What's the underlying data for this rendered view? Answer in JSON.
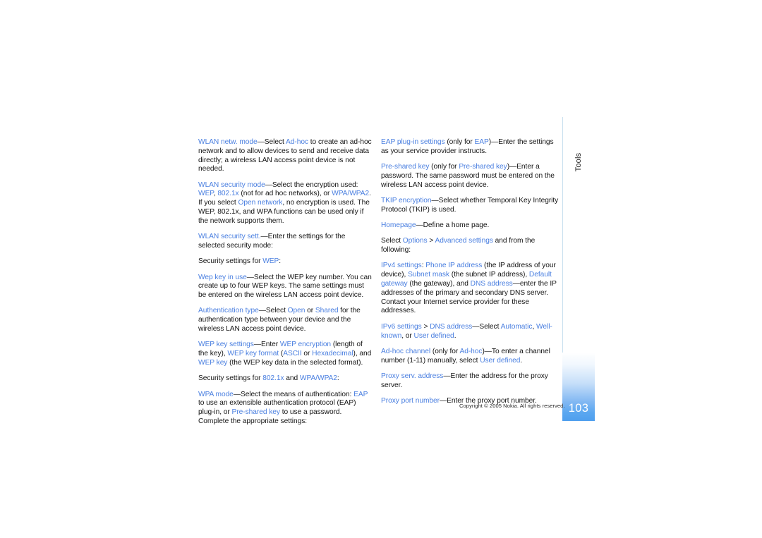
{
  "document": {
    "page_number": "103",
    "side_tab_label": "Tools",
    "copyright": "Copyright © 2005 Nokia. All rights reserved.",
    "accent_color": "#4a7fe0",
    "tab_color": "#5aa7f0"
  },
  "left_column": {
    "paragraphs": [
      {
        "id": "wlan-netw-mode",
        "runs": [
          {
            "t": "WLAN netw. mode",
            "k": true
          },
          {
            "t": "—Select "
          },
          {
            "t": "Ad-hoc",
            "k": true
          },
          {
            "t": " to create an ad-hoc network and to allow devices to send and receive data directly; a wireless LAN access point device is not needed."
          }
        ]
      },
      {
        "id": "wlan-security-mode",
        "runs": [
          {
            "t": "WLAN security mode",
            "k": true
          },
          {
            "t": "—Select the encryption used: "
          },
          {
            "t": "WEP",
            "k": true
          },
          {
            "t": ", "
          },
          {
            "t": "802.1x",
            "k": true
          },
          {
            "t": " (not for ad hoc networks), or "
          },
          {
            "t": "WPA/WPA2",
            "k": true
          },
          {
            "t": ". If you select "
          },
          {
            "t": "Open network",
            "k": true
          },
          {
            "t": ", no encryption is used. The WEP, 802.1x, and WPA functions can be used only if the network supports them."
          }
        ]
      },
      {
        "id": "wlan-security-sett",
        "runs": [
          {
            "t": "WLAN security sett.",
            "k": true
          },
          {
            "t": "—Enter the settings for the selected security mode:"
          }
        ]
      },
      {
        "id": "security-settings-wep",
        "runs": [
          {
            "t": "Security settings for "
          },
          {
            "t": "WEP",
            "k": true
          },
          {
            "t": ":"
          }
        ]
      },
      {
        "id": "wep-key-in-use",
        "runs": [
          {
            "t": "Wep key in use",
            "k": true
          },
          {
            "t": "—Select the WEP key number. You can create up to four WEP keys. The same settings must be entered on the wireless LAN access point device."
          }
        ]
      },
      {
        "id": "authentication-type",
        "runs": [
          {
            "t": "Authentication type",
            "k": true
          },
          {
            "t": "—Select "
          },
          {
            "t": "Open",
            "k": true
          },
          {
            "t": " or "
          },
          {
            "t": "Shared",
            "k": true
          },
          {
            "t": " for the authentication type between your device and the wireless LAN access point device."
          }
        ]
      },
      {
        "id": "wep-key-settings",
        "runs": [
          {
            "t": "WEP key settings",
            "k": true
          },
          {
            "t": "—Enter "
          },
          {
            "t": "WEP encryption",
            "k": true
          },
          {
            "t": " (length of the key), "
          },
          {
            "t": "WEP key format",
            "k": true
          },
          {
            "t": " ("
          },
          {
            "t": "ASCII",
            "k": true
          },
          {
            "t": " or "
          },
          {
            "t": "Hexadecimal",
            "k": true
          },
          {
            "t": "), and "
          },
          {
            "t": "WEP key",
            "k": true
          },
          {
            "t": " (the WEP key data in the selected format)."
          }
        ]
      },
      {
        "id": "security-settings-8021x",
        "runs": [
          {
            "t": "Security settings for "
          },
          {
            "t": "802.1x",
            "k": true
          },
          {
            "t": " and "
          },
          {
            "t": "WPA/WPA2",
            "k": true
          },
          {
            "t": ":"
          }
        ]
      },
      {
        "id": "wpa-mode",
        "runs": [
          {
            "t": "WPA mode",
            "k": true
          },
          {
            "t": "—Select the means of authentication: "
          },
          {
            "t": "EAP",
            "k": true
          },
          {
            "t": " to use an extensible authentication protocol (EAP) plug-in, or "
          },
          {
            "t": "Pre-shared key",
            "k": true
          },
          {
            "t": " to use a password. Complete the appropriate settings:"
          }
        ]
      }
    ]
  },
  "right_column": {
    "paragraphs": [
      {
        "id": "eap-plug-in-settings",
        "runs": [
          {
            "t": "EAP plug-in settings",
            "k": true
          },
          {
            "t": " (only for "
          },
          {
            "t": "EAP",
            "k": true
          },
          {
            "t": ")—Enter the settings as your service provider instructs."
          }
        ]
      },
      {
        "id": "pre-shared-key",
        "runs": [
          {
            "t": "Pre-shared key",
            "k": true
          },
          {
            "t": " (only for "
          },
          {
            "t": "Pre-shared key",
            "k": true
          },
          {
            "t": ")—Enter a password. The same password must be entered on the wireless LAN access point device."
          }
        ]
      },
      {
        "id": "tkip-encryption",
        "runs": [
          {
            "t": "TKIP encryption",
            "k": true
          },
          {
            "t": "—Select whether Temporal Key Integrity Protocol (TKIP) is used."
          }
        ]
      },
      {
        "id": "homepage",
        "runs": [
          {
            "t": "Homepage",
            "k": true
          },
          {
            "t": "—Define a home page."
          }
        ]
      },
      {
        "id": "select-options",
        "runs": [
          {
            "t": "Select "
          },
          {
            "t": "Options",
            "k": true
          },
          {
            "t": " > "
          },
          {
            "t": "Advanced settings",
            "k": true
          },
          {
            "t": " and from the following:"
          }
        ]
      },
      {
        "id": "ipv4-settings",
        "runs": [
          {
            "t": "IPv4 settings",
            "k": true
          },
          {
            "t": ": "
          },
          {
            "t": "Phone IP address",
            "k": true
          },
          {
            "t": " (the IP address of your device), "
          },
          {
            "t": "Subnet mask",
            "k": true
          },
          {
            "t": " (the subnet IP address), "
          },
          {
            "t": "Default gateway",
            "k": true
          },
          {
            "t": " (the gateway), and "
          },
          {
            "t": "DNS address",
            "k": true
          },
          {
            "t": "—enter the IP addresses of the primary and secondary DNS server. Contact your Internet service provider for these addresses."
          }
        ]
      },
      {
        "id": "ipv6-settings",
        "runs": [
          {
            "t": "IPv6 settings",
            "k": true
          },
          {
            "t": " > "
          },
          {
            "t": "DNS address",
            "k": true
          },
          {
            "t": "—Select "
          },
          {
            "t": "Automatic",
            "k": true
          },
          {
            "t": ", "
          },
          {
            "t": "Well-known",
            "k": true
          },
          {
            "t": ", or "
          },
          {
            "t": "User defined",
            "k": true
          },
          {
            "t": "."
          }
        ]
      },
      {
        "id": "ad-hoc-channel",
        "runs": [
          {
            "t": "Ad-hoc channel",
            "k": true
          },
          {
            "t": " (only for "
          },
          {
            "t": "Ad-hoc",
            "k": true
          },
          {
            "t": ")—To enter a channel number (1-11) manually, select "
          },
          {
            "t": "User defined",
            "k": true
          },
          {
            "t": "."
          }
        ]
      },
      {
        "id": "proxy-serv-address",
        "runs": [
          {
            "t": "Proxy serv. address",
            "k": true
          },
          {
            "t": "—Enter the address for the proxy server."
          }
        ]
      },
      {
        "id": "proxy-port-number",
        "runs": [
          {
            "t": "Proxy port number",
            "k": true
          },
          {
            "t": "—Enter the proxy port number."
          }
        ]
      }
    ]
  }
}
